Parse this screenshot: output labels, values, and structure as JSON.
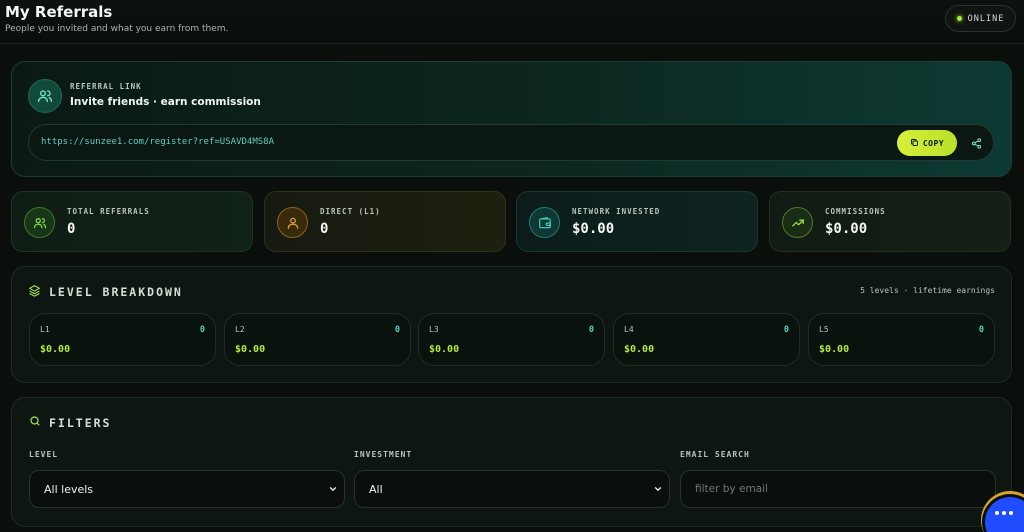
{
  "header": {
    "title": "My Referrals",
    "subtitle": "People you invited and what you earn from them.",
    "status": "ONLINE"
  },
  "referral": {
    "label": "REFERRAL LINK",
    "heading": "Invite friends · earn commission",
    "link": "https://sunzee1.com/register?ref=USAVD4MS8A",
    "copy_label": "COPY"
  },
  "stats": [
    {
      "label": "TOTAL REFERRALS",
      "value": "0",
      "icon": "users-icon",
      "color": "#8fe04a"
    },
    {
      "label": "DIRECT (L1)",
      "value": "0",
      "icon": "user-icon",
      "color": "#e8a93a"
    },
    {
      "label": "NETWORK INVESTED",
      "value": "$0.00",
      "icon": "wallet-icon",
      "color": "#3fd2c4"
    },
    {
      "label": "COMMISSIONS",
      "value": "$0.00",
      "icon": "trending-up-icon",
      "color": "#9be04a"
    }
  ],
  "levels": {
    "title": "LEVEL BREAKDOWN",
    "meta": "5 levels · lifetime earnings",
    "items": [
      {
        "name": "L1",
        "count": "0",
        "amount": "$0.00"
      },
      {
        "name": "L2",
        "count": "0",
        "amount": "$0.00"
      },
      {
        "name": "L3",
        "count": "0",
        "amount": "$0.00"
      },
      {
        "name": "L4",
        "count": "0",
        "amount": "$0.00"
      },
      {
        "name": "L5",
        "count": "0",
        "amount": "$0.00"
      }
    ]
  },
  "filters": {
    "title": "FILTERS",
    "level_label": "LEVEL",
    "level_value": "All levels",
    "investment_label": "INVESTMENT",
    "investment_value": "All",
    "email_label": "EMAIL SEARCH",
    "email_placeholder": "filter by email"
  }
}
